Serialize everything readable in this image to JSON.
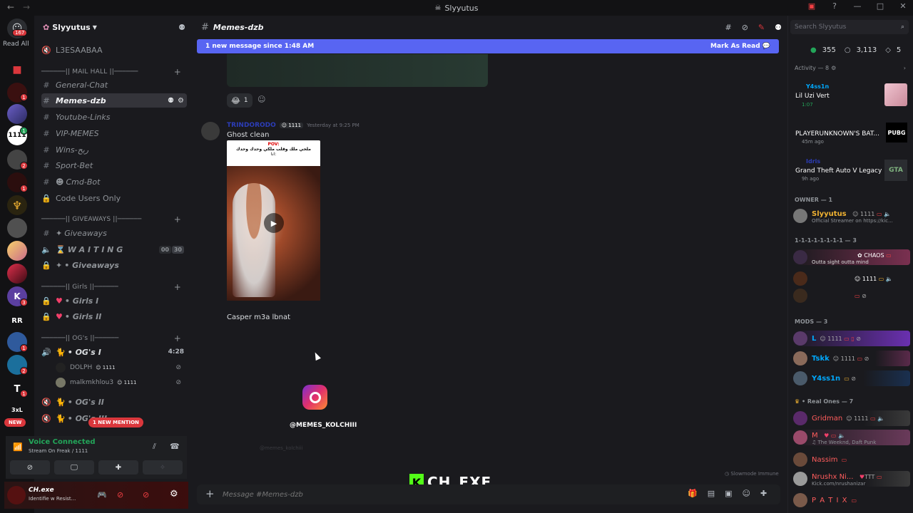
{
  "window": {
    "title": "Slyyutus",
    "back": "←",
    "forward": "→"
  },
  "rail": {
    "read_all": "Read All",
    "badge_main": "167",
    "new_label": "NEW",
    "badges": [
      "1",
      "1",
      "1",
      "2",
      "1",
      "1",
      "3",
      "1",
      "2",
      "1"
    ],
    "text_server": "3xL"
  },
  "server": {
    "name": "Slyyutus"
  },
  "channels": {
    "top": "L3ESAABAA",
    "cat_mail": "──────|| MAIL HALL ||──────",
    "general": "General-Chat",
    "memes": "Memes-dzb",
    "youtube": "Youtube-Links",
    "vip": "VIP-MEMES",
    "wins": "Wins-ربح",
    "sport": "Sport-Bet",
    "cmd": "Cmd-Bot",
    "code": "Code Users Only",
    "cat_give": "──────|| GIVEAWAYS ||──────",
    "giveaways1": "Giveaways",
    "waiting": "W A I T I N G",
    "waiting_c1": "00",
    "waiting_c2": "30",
    "giveaways2": "• Giveaways",
    "cat_girls": "──────|| Girls ||──────",
    "girls1": "• Girls I",
    "girls2": "• Girls II",
    "cat_og": "──────|| OG's ||──────",
    "og1": "• OG's I",
    "og1_time": "4:28",
    "user1": "DOLPH",
    "user1_tag": "1111",
    "user2": "malkmkhlou3",
    "user2_tag": "1111",
    "og2": "• OG's II",
    "og3": "• OG's III",
    "mention": "1 NEW MENTION"
  },
  "voice": {
    "status": "Voice Connected",
    "sub": "Stream On Freak / 1111"
  },
  "user": {
    "name": "CH.exe",
    "status": "Identifie w Resist..."
  },
  "header": {
    "channel": "Memes-dzb"
  },
  "banner": {
    "text": "1 new message since 1:48 AM",
    "action": "Mark As Read"
  },
  "reaction": {
    "emoji": "😂",
    "count": "1"
  },
  "message": {
    "author": "TRINDORODO",
    "tag": "1111",
    "time": "Yesterday at 9:25 PM",
    "text1": "Ghost clean",
    "video_caption": "POV:",
    "video_line1": "ملحي ملك وقلب ملكي وحدك وحدك",
    "video_line2": "انا:",
    "text2": "Casper m3a lbnat"
  },
  "instagram": {
    "handle": "@MEMES_KOLCHIII",
    "faint": "@memes_kolchiii"
  },
  "watermark": {
    "k": "K",
    "text": "CH_EXE"
  },
  "composer": {
    "placeholder": "Message #Memes-dzb",
    "slowmode": "Slowmode Immune"
  },
  "search": {
    "placeholder": "Search Slyyutus"
  },
  "stats": {
    "online": "355",
    "members": "3,113",
    "boosts": "5"
  },
  "activity": {
    "title": "Activity — 8",
    "items": [
      {
        "user": "Y4ss1n",
        "title": "Lil Uzi Vert",
        "sub": "1:07"
      },
      {
        "user": "",
        "title": "PLAYERUNKNOWN'S BAT...",
        "sub": "45m ago",
        "logo": "PUBG"
      },
      {
        "user": "Idris",
        "title": "Grand Theft Auto V Legacy",
        "sub": "9h ago",
        "logo": "GTA"
      }
    ]
  },
  "owner": {
    "title": "OWNER — 1",
    "name": "Slyyutus",
    "tag": "1111",
    "status": "Official Streamer on https://kic..."
  },
  "group": {
    "title": "1-1-1-1-1-1-1-1 — 3",
    "m1_tag": "CHAOS",
    "m1_status": "Outta sight outta mind",
    "m2_tag": "1111"
  },
  "mods": {
    "title": "MODS — 3",
    "list": [
      {
        "name": "L",
        "tag": "1111"
      },
      {
        "name": "Tskk",
        "tag": "1111"
      },
      {
        "name": "Y4ss1n"
      }
    ]
  },
  "real": {
    "title": "• Real Ones — 7",
    "list": [
      {
        "name": "Gridman",
        "tag": "1111"
      },
      {
        "name": "M",
        "status": "The Weeknd, Daft Punk"
      },
      {
        "name": "Nassim"
      },
      {
        "name": "Nrushx Ni...",
        "tag": "TTT",
        "status": "Kick.com/nrushanizar"
      },
      {
        "name": "P A T I X"
      }
    ]
  },
  "colors": {
    "accent": "#5865f2",
    "online": "#23a559",
    "owner": "#f0b232",
    "mods": "#00a8fc",
    "real": "#ff5c5c"
  }
}
